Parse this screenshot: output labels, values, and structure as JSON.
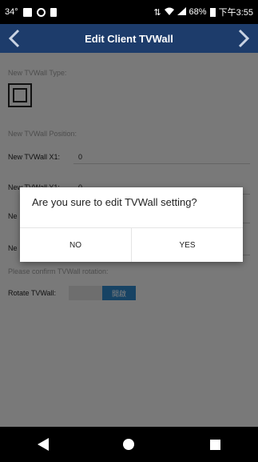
{
  "status_bar": {
    "temperature": "34°",
    "battery_percent": "68%",
    "time": "下午3:55"
  },
  "header": {
    "title": "Edit Client TVWall",
    "back_icon": "chevron-left-icon",
    "forward_icon": "chevron-right-icon"
  },
  "form": {
    "type_label": "New TVWall Type:",
    "position_label": "New TVWall Position:",
    "fields": [
      {
        "label": "New TVWall X1:",
        "value": "0"
      },
      {
        "label": "New TVWall Y1:",
        "value": "0"
      },
      {
        "label": "Ne",
        "value": ""
      },
      {
        "label": "Ne",
        "value": ""
      }
    ],
    "rotation_label": "Please confirm TVWall rotation:",
    "rotate_label": "Rotate TVWall:",
    "rotate_toggle_on": "開啟"
  },
  "dialog": {
    "message": "Are you sure to edit TVWall setting?",
    "no_label": "NO",
    "yes_label": "YES"
  },
  "nav": {
    "back_icon": "triangle-back-icon",
    "home_icon": "circle-home-icon",
    "recents_icon": "square-recents-icon"
  },
  "colors": {
    "header_bg": "#1d3c6b",
    "toggle_on": "#2e86c9"
  }
}
